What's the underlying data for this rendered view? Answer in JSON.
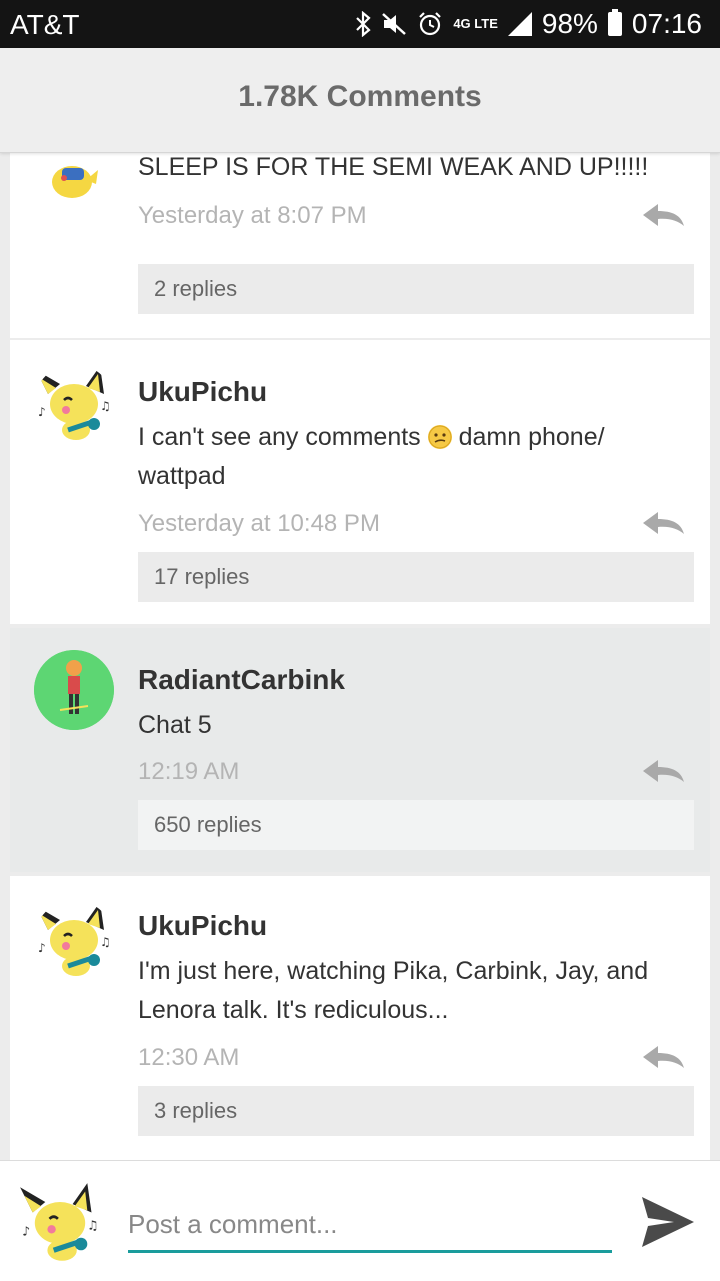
{
  "status_bar": {
    "carrier": "AT&T",
    "network": "4G LTE",
    "battery": "98%",
    "time": "07:16",
    "icons": [
      "bluetooth-icon",
      "mute-icon",
      "alarm-icon",
      "network-4g-icon",
      "signal-icon",
      "battery-icon"
    ]
  },
  "header": {
    "title": "1.78K Comments"
  },
  "comments": [
    {
      "username": "",
      "text": "SLEEP IS FOR THE SEMI WEAK AND UP!!!!!",
      "timestamp": "Yesterday at 8:07 PM",
      "replies": "2 replies"
    },
    {
      "username": "UkuPichu",
      "text_before": "I can't see any comments",
      "text_after": "damn phone/ wattpad",
      "emoji": "confused-face",
      "timestamp": "Yesterday at 10:48 PM",
      "replies": "17 replies"
    },
    {
      "username": "RadiantCarbink",
      "text": "Chat 5",
      "timestamp": "12:19 AM",
      "replies": "650 replies",
      "highlighted": true
    },
    {
      "username": "UkuPichu",
      "text": "I'm just here, watching Pika, Carbink, Jay, and Lenora talk.  It's rediculous...",
      "timestamp": "12:30 AM",
      "replies": "3 replies"
    }
  ],
  "composer": {
    "placeholder": "Post a comment..."
  },
  "colors": {
    "accent": "#1a9c9c",
    "status_bar": "#141414",
    "highlight": "#e8eaea"
  }
}
